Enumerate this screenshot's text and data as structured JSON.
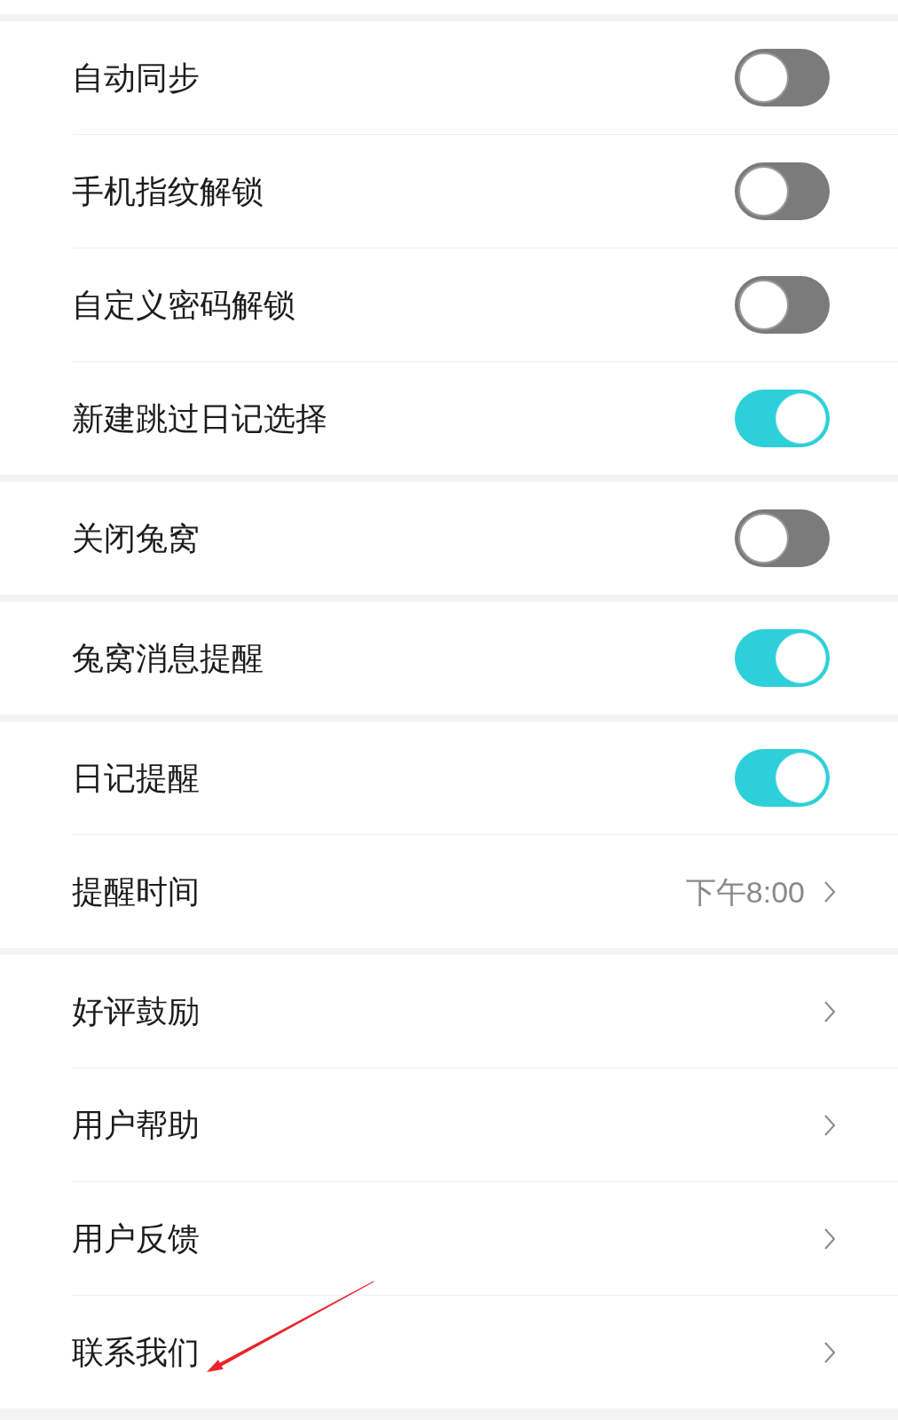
{
  "groups": [
    {
      "items": [
        {
          "kind": "toggle",
          "label": "自动同步",
          "on": false
        },
        {
          "kind": "toggle",
          "label": "手机指纹解锁",
          "on": false
        },
        {
          "kind": "toggle",
          "label": "自定义密码解锁",
          "on": false
        },
        {
          "kind": "toggle",
          "label": "新建跳过日记选择",
          "on": true
        }
      ]
    },
    {
      "items": [
        {
          "kind": "toggle",
          "label": "关闭兔窝",
          "on": false
        }
      ]
    },
    {
      "items": [
        {
          "kind": "toggle",
          "label": "兔窝消息提醒",
          "on": true
        }
      ]
    },
    {
      "items": [
        {
          "kind": "toggle",
          "label": "日记提醒",
          "on": true
        },
        {
          "kind": "link",
          "label": "提醒时间",
          "value": "下午8:00"
        }
      ]
    },
    {
      "items": [
        {
          "kind": "link",
          "label": "好评鼓励"
        },
        {
          "kind": "link",
          "label": "用户帮助"
        },
        {
          "kind": "link",
          "label": "用户反馈"
        },
        {
          "kind": "link",
          "label": "联系我们"
        }
      ]
    }
  ]
}
